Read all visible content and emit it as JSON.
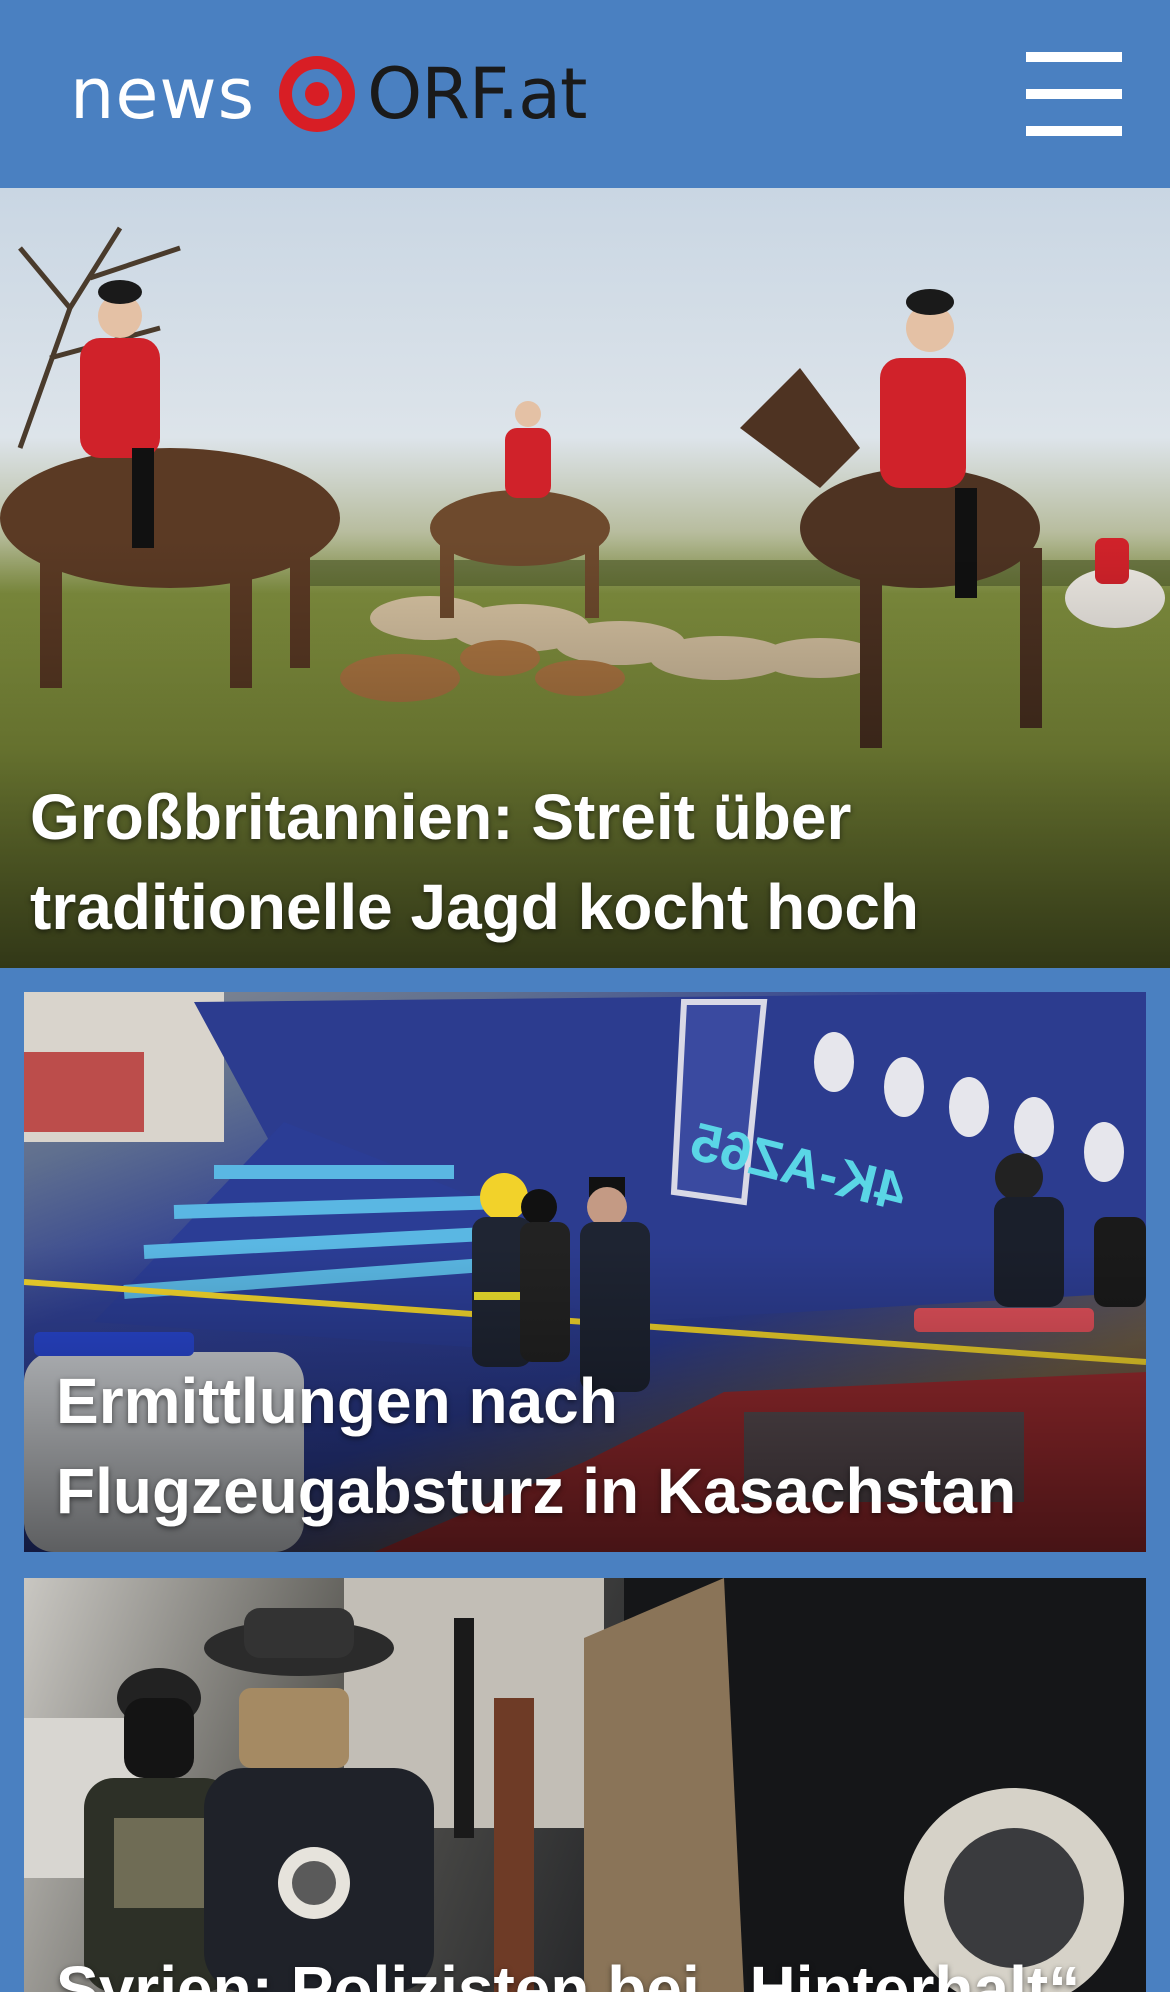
{
  "header": {
    "logo_news": "news",
    "logo_orf": "ORF.at",
    "menu_icon": "hamburger-menu-icon",
    "brand_color": "#4a80c1",
    "logo_accent": "#d81e25"
  },
  "stories": [
    {
      "headline": "Großbritannien: Streit über traditionelle Jagd kocht hoch"
    },
    {
      "headline": "Ermittlungen nach Flugzeugabsturz in Kasachstan"
    },
    {
      "headline": "Syrien: Polizisten bei „Hinterhalt“"
    }
  ]
}
